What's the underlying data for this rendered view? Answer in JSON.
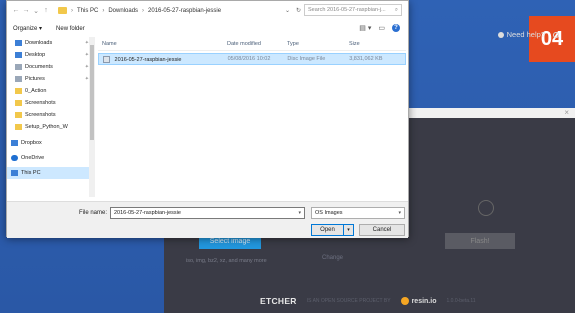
{
  "badge": "04",
  "dialog": {
    "breadcrumb": [
      "This PC",
      "Downloads",
      "2016-05-27-raspbian-jessie"
    ],
    "search_placeholder": "Search 2016-05-27-raspbian-j...",
    "toolbar": {
      "organize": "Organize ▾",
      "new_folder": "New folder",
      "help": "?"
    },
    "nav_items": [
      {
        "label": "Downloads",
        "icon": "downloads-icon",
        "pinned": true
      },
      {
        "label": "Desktop",
        "icon": "desktop-icon",
        "pinned": true
      },
      {
        "label": "Documents",
        "icon": "documents-icon",
        "pinned": true
      },
      {
        "label": "Pictures",
        "icon": "pictures-icon",
        "pinned": true
      },
      {
        "label": "0_Action",
        "icon": "folder-icon",
        "pinned": false
      },
      {
        "label": "Screenshots",
        "icon": "folder-icon",
        "pinned": false
      },
      {
        "label": "Screenshots",
        "icon": "folder-icon",
        "pinned": false
      },
      {
        "label": "Setup_Python_W",
        "icon": "folder-icon",
        "pinned": false
      },
      {
        "label": "Dropbox",
        "icon": "dropbox-icon",
        "pinned": false
      },
      {
        "label": "OneDrive",
        "icon": "onedrive-icon",
        "pinned": false
      },
      {
        "label": "This PC",
        "icon": "this-pc-icon",
        "pinned": false
      }
    ],
    "columns": [
      "Name",
      "Date modified",
      "Type",
      "Size"
    ],
    "files": [
      {
        "name": "2016-05-27-raspbian-jessie",
        "date": "05/08/2016 10:02",
        "type": "Disc Image File",
        "size": "3,831,062 KB"
      }
    ],
    "file_name_label": "File name:",
    "file_name_value": "2016-05-27-raspbian-jessie",
    "file_type": "OS Images",
    "open_label": "Open",
    "cancel_label": "Cancel"
  },
  "etcher": {
    "close": "×",
    "help": "Need help?",
    "select_image": "Select image",
    "flash": "Flash!",
    "formats": "iso, img, bz2, xz, and many more",
    "change": "Change",
    "logo": "ETCHER",
    "footer_note": "IS AN OPEN SOURCE PROJECT BY",
    "resin": "resin.io",
    "version": "1.0.0-beta.11"
  }
}
